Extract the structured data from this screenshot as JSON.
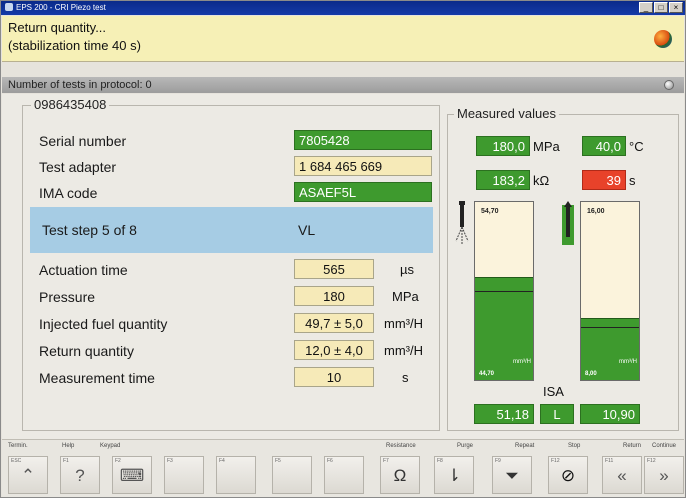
{
  "window": {
    "title": "EPS 200 - CRI Piezo test",
    "buttons": [
      "_",
      "□",
      "×"
    ]
  },
  "banner": {
    "line1": "Return quantity...",
    "line2": "(stabilization time 40 s)",
    "icon": "globe-icon"
  },
  "protocol": {
    "label": "Number of tests in protocol: 0"
  },
  "left_panel": {
    "title": "0986435408",
    "rows": [
      {
        "label": "Serial number",
        "value": "7805428",
        "style": "green"
      },
      {
        "label": "Test adapter",
        "value": "1 684 465 669",
        "style": "yellow"
      },
      {
        "label": "IMA code",
        "value": "ASAEF5L",
        "style": "green"
      }
    ],
    "step": {
      "label": "Test step 5 of 8",
      "value": "VL"
    },
    "params": [
      {
        "label": "Actuation time",
        "value": "565",
        "unit": "µs"
      },
      {
        "label": "Pressure",
        "value": "180",
        "unit": "MPa"
      },
      {
        "label": "Injected fuel quantity",
        "value": "49,7 ± 5,0",
        "unit": "mm³/H"
      },
      {
        "label": "Return quantity",
        "value": "12,0 ± 4,0",
        "unit": "mm³/H"
      },
      {
        "label": "Measurement time",
        "value": "10",
        "unit": "s"
      }
    ]
  },
  "right_panel": {
    "title": "Measured values",
    "pressure": {
      "value": "180,0",
      "unit": "MPa"
    },
    "temperature": {
      "value": "40,0",
      "unit": "°C"
    },
    "resistance": {
      "value": "183,2",
      "unit": "kΩ"
    },
    "time": {
      "value": "39",
      "unit": "s"
    },
    "gauge_left": {
      "top": "54,70",
      "unit": "mm³/H",
      "bottom": "44,70",
      "level": 0.58,
      "reference_level": 0.5
    },
    "gauge_right": {
      "top": "16,00",
      "unit": "mm³/H",
      "bottom": "8,00",
      "level": 0.35,
      "reference_level": 0.3
    },
    "isa_label": "ISA",
    "result_left": "51,18",
    "result_mid": "L",
    "result_right": "10,90"
  },
  "toolbar": {
    "labels": {
      "termin": "Termin.",
      "help": "Help",
      "keypad": "Keypad",
      "resistance": "Resistance",
      "purge": "Purge",
      "repeat": "Repeat",
      "stop": "Stop",
      "return": "Return",
      "continue": "Continue"
    },
    "keys": [
      {
        "num": "ESC",
        "icon": "⌃"
      },
      {
        "num": "F1",
        "icon": "?"
      },
      {
        "num": "F2",
        "icon": "⌨"
      },
      {
        "num": "F3",
        "icon": ""
      },
      {
        "num": "F4",
        "icon": ""
      },
      {
        "num": "F5",
        "icon": ""
      },
      {
        "num": "F6",
        "icon": ""
      },
      {
        "num": "F7",
        "icon": "Ω"
      },
      {
        "num": "F8",
        "icon": "⇂"
      },
      {
        "num": "F9",
        "icon": "⏷"
      },
      {
        "num": "F12",
        "icon": "⊘"
      },
      {
        "num": "F11",
        "icon": "«"
      },
      {
        "num": "F12",
        "icon": "»"
      }
    ]
  }
}
